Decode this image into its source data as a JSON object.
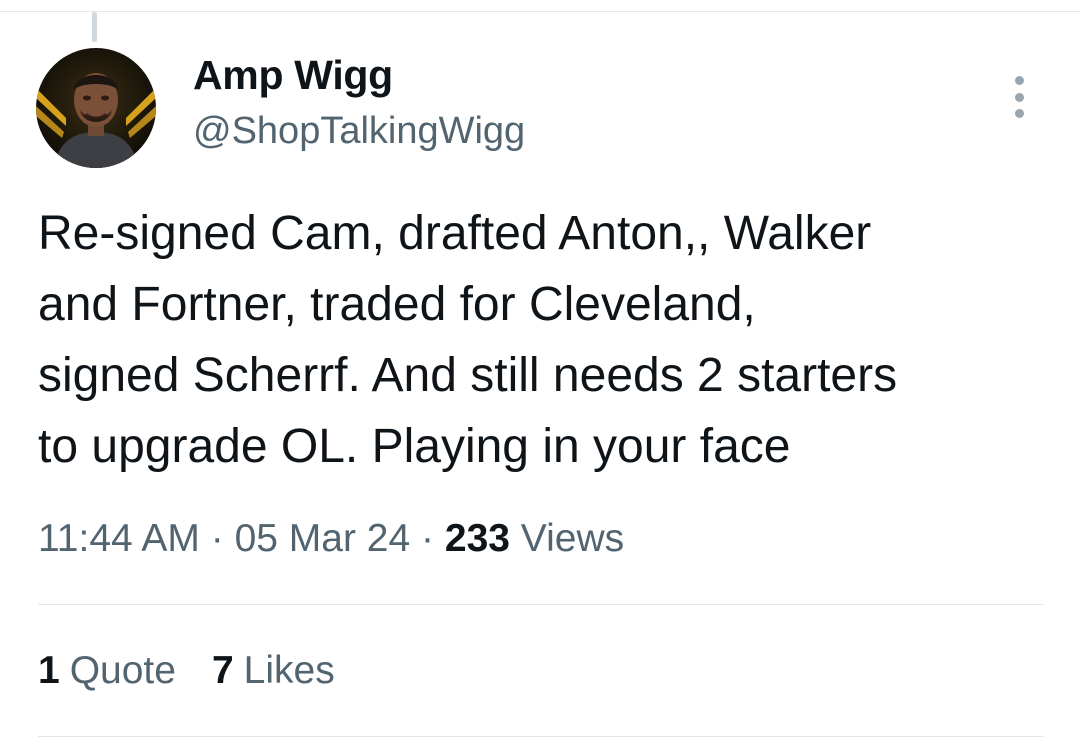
{
  "tweet": {
    "author": {
      "display_name": "Amp Wigg",
      "handle": "@ShopTalkingWigg",
      "avatar_icon": "profile-avatar"
    },
    "more_icon": "more-vertical-icon",
    "text": "Re-signed Cam, drafted Anton,, Walker\nand Fortner, traded for Cleveland,\nsigned Scherrf. And still needs 2 starters\nto upgrade OL. Playing in your face",
    "time": "11:44 AM",
    "separator": "·",
    "date": "05 Mar 24",
    "views_count": "233",
    "views_label": "Views",
    "quotes_count": "1",
    "quotes_label": "Quote",
    "likes_count": "7",
    "likes_label": "Likes"
  },
  "colors": {
    "text_primary": "#0f1419",
    "text_secondary": "#536471",
    "divider": "#e1e6e9"
  }
}
